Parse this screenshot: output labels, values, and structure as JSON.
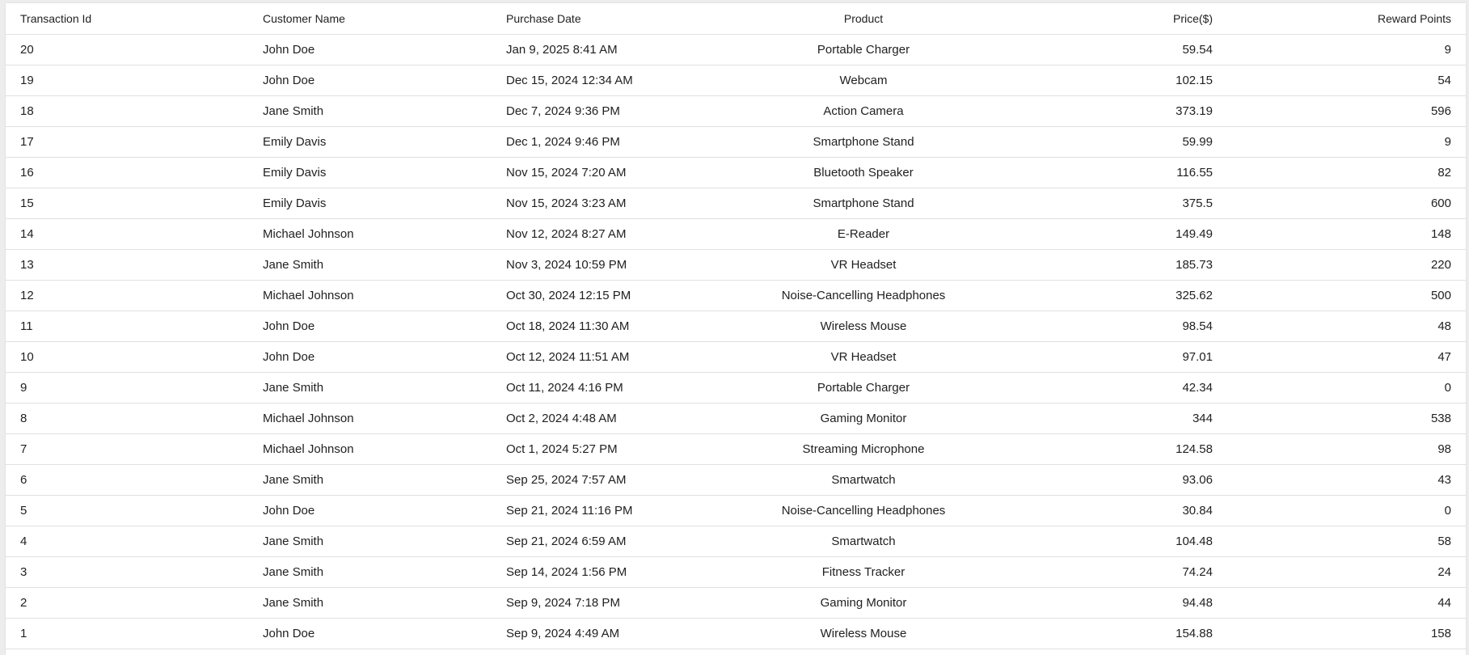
{
  "table": {
    "headers": {
      "transaction_id": "Transaction Id",
      "customer_name": "Customer Name",
      "purchase_date": "Purchase Date",
      "product": "Product",
      "price": "Price($)",
      "reward_points": "Reward Points"
    },
    "rows": [
      {
        "id": "20",
        "customer": "John Doe",
        "date": "Jan 9, 2025 8:41 AM",
        "product": "Portable Charger",
        "price": "59.54",
        "points": "9"
      },
      {
        "id": "19",
        "customer": "John Doe",
        "date": "Dec 15, 2024 12:34 AM",
        "product": "Webcam",
        "price": "102.15",
        "points": "54"
      },
      {
        "id": "18",
        "customer": "Jane Smith",
        "date": "Dec 7, 2024 9:36 PM",
        "product": "Action Camera",
        "price": "373.19",
        "points": "596"
      },
      {
        "id": "17",
        "customer": "Emily Davis",
        "date": "Dec 1, 2024 9:46 PM",
        "product": "Smartphone Stand",
        "price": "59.99",
        "points": "9"
      },
      {
        "id": "16",
        "customer": "Emily Davis",
        "date": "Nov 15, 2024 7:20 AM",
        "product": "Bluetooth Speaker",
        "price": "116.55",
        "points": "82"
      },
      {
        "id": "15",
        "customer": "Emily Davis",
        "date": "Nov 15, 2024 3:23 AM",
        "product": "Smartphone Stand",
        "price": "375.5",
        "points": "600"
      },
      {
        "id": "14",
        "customer": "Michael Johnson",
        "date": "Nov 12, 2024 8:27 AM",
        "product": "E-Reader",
        "price": "149.49",
        "points": "148"
      },
      {
        "id": "13",
        "customer": "Jane Smith",
        "date": "Nov 3, 2024 10:59 PM",
        "product": "VR Headset",
        "price": "185.73",
        "points": "220"
      },
      {
        "id": "12",
        "customer": "Michael Johnson",
        "date": "Oct 30, 2024 12:15 PM",
        "product": "Noise-Cancelling Headphones",
        "price": "325.62",
        "points": "500"
      },
      {
        "id": "11",
        "customer": "John Doe",
        "date": "Oct 18, 2024 11:30 AM",
        "product": "Wireless Mouse",
        "price": "98.54",
        "points": "48"
      },
      {
        "id": "10",
        "customer": "John Doe",
        "date": "Oct 12, 2024 11:51 AM",
        "product": "VR Headset",
        "price": "97.01",
        "points": "47"
      },
      {
        "id": "9",
        "customer": "Jane Smith",
        "date": "Oct 11, 2024 4:16 PM",
        "product": "Portable Charger",
        "price": "42.34",
        "points": "0"
      },
      {
        "id": "8",
        "customer": "Michael Johnson",
        "date": "Oct 2, 2024 4:48 AM",
        "product": "Gaming Monitor",
        "price": "344",
        "points": "538"
      },
      {
        "id": "7",
        "customer": "Michael Johnson",
        "date": "Oct 1, 2024 5:27 PM",
        "product": "Streaming Microphone",
        "price": "124.58",
        "points": "98"
      },
      {
        "id": "6",
        "customer": "Jane Smith",
        "date": "Sep 25, 2024 7:57 AM",
        "product": "Smartwatch",
        "price": "93.06",
        "points": "43"
      },
      {
        "id": "5",
        "customer": "John Doe",
        "date": "Sep 21, 2024 11:16 PM",
        "product": "Noise-Cancelling Headphones",
        "price": "30.84",
        "points": "0"
      },
      {
        "id": "4",
        "customer": "Jane Smith",
        "date": "Sep 21, 2024 6:59 AM",
        "product": "Smartwatch",
        "price": "104.48",
        "points": "58"
      },
      {
        "id": "3",
        "customer": "Jane Smith",
        "date": "Sep 14, 2024 1:56 PM",
        "product": "Fitness Tracker",
        "price": "74.24",
        "points": "24"
      },
      {
        "id": "2",
        "customer": "Jane Smith",
        "date": "Sep 9, 2024 7:18 PM",
        "product": "Gaming Monitor",
        "price": "94.48",
        "points": "44"
      },
      {
        "id": "1",
        "customer": "John Doe",
        "date": "Sep 9, 2024 4:49 AM",
        "product": "Wireless Mouse",
        "price": "154.88",
        "points": "158"
      }
    ]
  }
}
